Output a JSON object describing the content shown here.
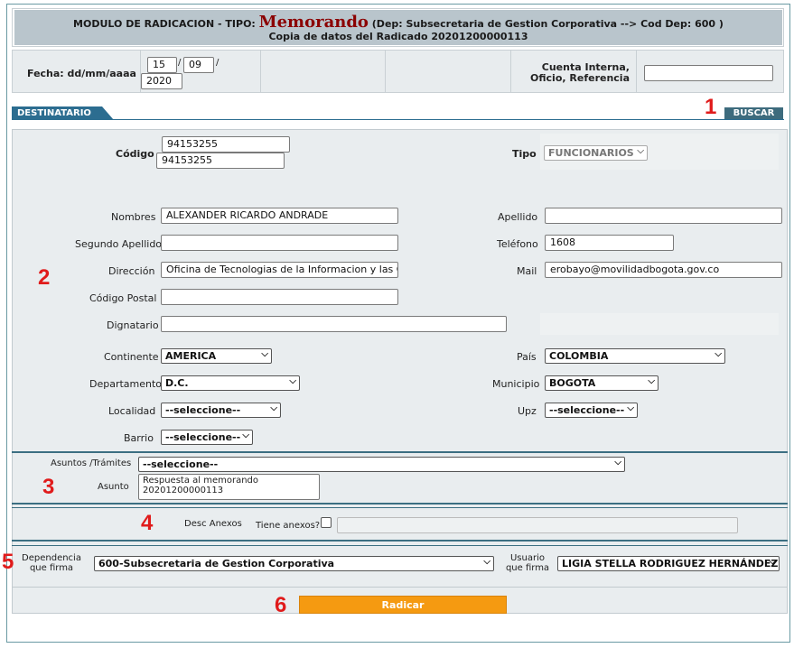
{
  "header": {
    "modulo": "MODULO DE RADICACION - TIPO:",
    "tipo": "Memorando",
    "dependencia": "(Dep: Subsecretaria de Gestion Corporativa --> Cod Dep: 600 )",
    "copia": "Copia de datos del Radicado 20201200000113"
  },
  "fecha": {
    "label": "Fecha: dd/mm/aaaa",
    "day": "15",
    "month": "09",
    "year": "2020",
    "sep": "/"
  },
  "cuenta": {
    "label_line1": "Cuenta Interna,",
    "label_line2": "Oficio, Referencia",
    "value": ""
  },
  "tab": {
    "label": "DESTINATARIO"
  },
  "buscar": {
    "label": "BUSCAR"
  },
  "markers": {
    "m1": "1",
    "m2": "2",
    "m3": "3",
    "m4": "4",
    "m5": "5",
    "m6": "6"
  },
  "destinatario": {
    "codigo_label": "Código",
    "codigo_1": "94153255",
    "codigo_2": "94153255",
    "tipo_label": "Tipo",
    "tipo_value": "FUNCIONARIOS",
    "nombres_label": "Nombres",
    "nombres_value": "ALEXANDER RICARDO ANDRADE",
    "apellido_label": "Apellido",
    "apellido_value": "",
    "segundo_apellido_label": "Segundo Apellido",
    "segundo_apellido_value": "",
    "telefono_label": "Teléfono",
    "telefono_value": "1608",
    "direccion_label": "Dirección",
    "direccion_value": "Oficina de Tecnologias de la Informacion y las Con",
    "mail_label": "Mail",
    "mail_value": "erobayo@movilidadbogota.gov.co",
    "codigo_postal_label": "Código Postal",
    "codigo_postal_value": "",
    "dignatario_label": "Dignatario",
    "dignatario_value": "",
    "continente_label": "Continente",
    "continente_value": "AMERICA",
    "pais_label": "País",
    "pais_value": "COLOMBIA",
    "departamento_label": "Departamento",
    "departamento_value": "D.C.",
    "municipio_label": "Municipio",
    "municipio_value": "BOGOTA",
    "localidad_label": "Localidad",
    "localidad_value": "--seleccione--",
    "upz_label": "Upz",
    "upz_value": "--seleccione--",
    "barrio_label": "Barrio",
    "barrio_value": "--seleccione--"
  },
  "asuntos": {
    "tramites_label": "Asuntos /Trámites",
    "tramites_value": "--seleccione--",
    "asunto_label": "Asunto",
    "asunto_line1": "Respuesta al memorando",
    "asunto_line2": "20201200000113"
  },
  "anexos": {
    "desc_label": "Desc Anexos",
    "tiene_label": "Tiene anexos?"
  },
  "firma": {
    "dependencia_line1": "Dependencia",
    "dependencia_line2": "que firma",
    "dependencia_value": "600-Subsecretaria de Gestion Corporativa",
    "usuario_line1": "Usuario",
    "usuario_line2": "que firma",
    "usuario_value": "LIGIA STELLA RODRIGUEZ HERNÁNDEZ"
  },
  "radicar": {
    "label": "Radicar"
  },
  "icons": {
    "select_arrow": "chevron-down-icon"
  },
  "colors": {
    "tab": "#2c6d90",
    "radicar": "#f59a11",
    "tipo": "#8b0000",
    "marker": "#e01b1b"
  }
}
